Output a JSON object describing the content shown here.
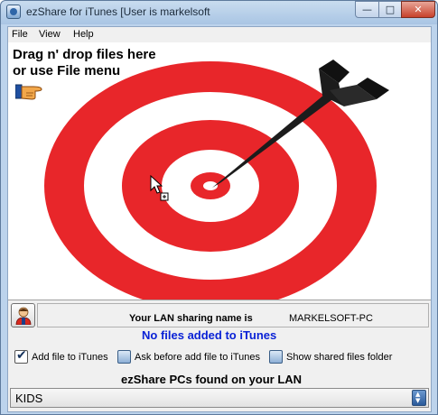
{
  "window": {
    "title": "ezShare for iTunes [User is markelsoft",
    "minimize_glyph": "—",
    "maximize_glyph": "□",
    "close_glyph": "✕"
  },
  "menu": {
    "items": [
      {
        "label": "File"
      },
      {
        "label": "View"
      },
      {
        "label": "Help"
      }
    ]
  },
  "dropzone": {
    "hint": "Drag n' drop files here\nor use File menu",
    "graphic_icons": [
      "pointing-hand-icon",
      "target-icon",
      "arrow-icon",
      "drag-cursor-icon"
    ]
  },
  "lan": {
    "label": "Your LAN sharing name is",
    "name": "MARKELSOFT-PC"
  },
  "status": {
    "text": "No files added to iTunes",
    "color": "#0a22d6"
  },
  "options": [
    {
      "label": "Add file to iTunes",
      "checked": true
    },
    {
      "label": "Ask before add file to iTunes",
      "checked": false
    },
    {
      "label": "Show shared files folder",
      "checked": false
    }
  ],
  "pcs": {
    "header": "ezShare PCs found on your LAN",
    "selected": "KIDS"
  },
  "colors": {
    "target_red": "#e8262a",
    "accent_blue": "#2a5a9a"
  }
}
